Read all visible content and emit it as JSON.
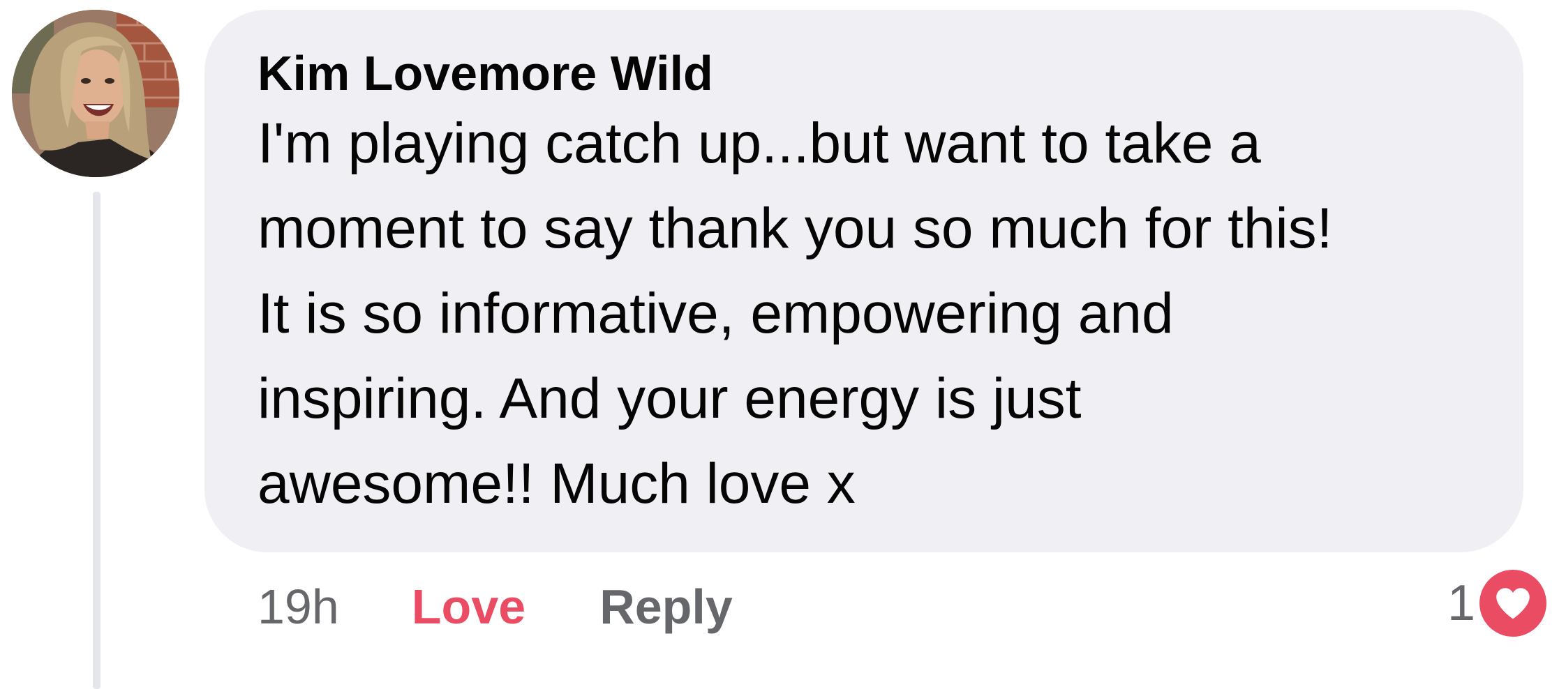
{
  "comment": {
    "author": "Kim Lovemore Wild",
    "text": "I'm playing catch up...but want to take a\nmoment to say thank you so much for this!\nIt is so informative, empowering and\ninspiring. And your energy is just\nawesome!! Much love x",
    "avatar_icon": "profile-photo",
    "timestamp": "19h",
    "actions": {
      "love_label": "Love",
      "reply_label": "Reply"
    },
    "reactions": {
      "count": "1",
      "icon": "heart-icon"
    }
  },
  "colors": {
    "bubble_background": "#f0f0f4",
    "love_accent": "#e94c63",
    "muted_text": "#65676b",
    "thread_line": "#e4e6eb"
  }
}
